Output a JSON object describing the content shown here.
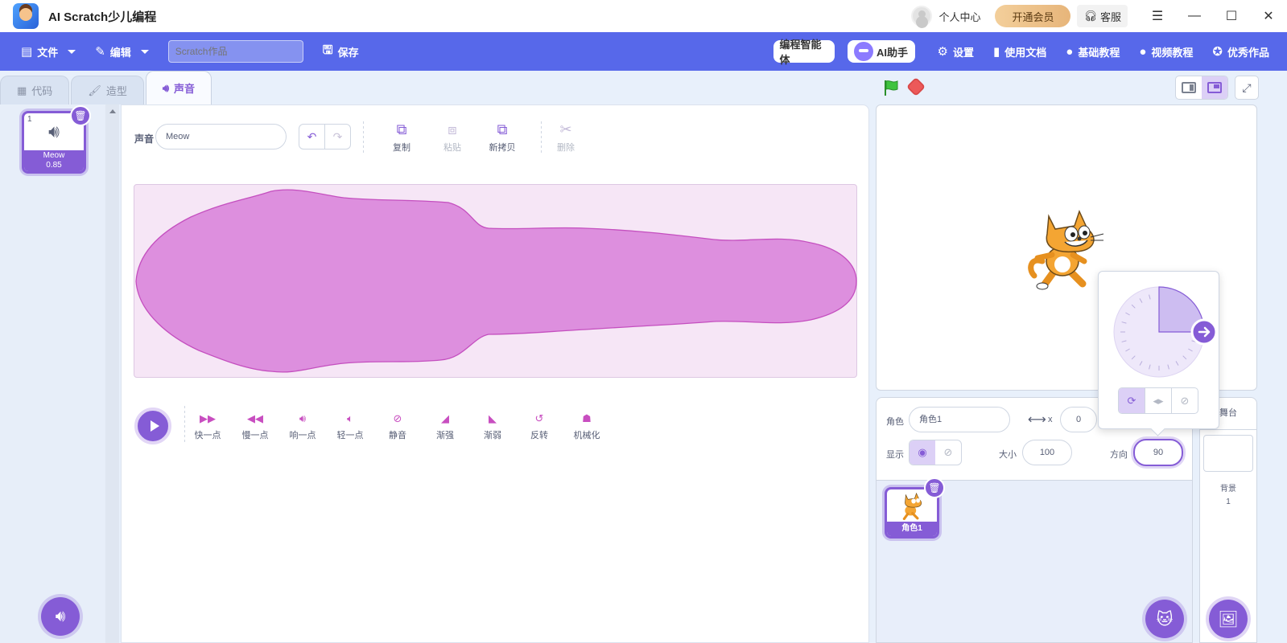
{
  "titlebar": {
    "app_title": "AI Scratch少儿编程",
    "user_center": "个人中心",
    "vip_button": "开通会员",
    "service_button": "客服"
  },
  "menubar": {
    "file": "文件",
    "edit": "编辑",
    "project_placeholder": "Scratch作品",
    "save": "保存",
    "smart_agent": "编程智能体",
    "ai_assistant": "AI助手",
    "settings": "设置",
    "docs": "使用文档",
    "basic_tutorial": "基础教程",
    "video_tutorial": "视频教程",
    "featured": "优秀作品"
  },
  "tabs": [
    {
      "label": "代码",
      "active": false
    },
    {
      "label": "造型",
      "active": false
    },
    {
      "label": "声音",
      "active": true
    }
  ],
  "sound_list": [
    {
      "index": "1",
      "name": "Meow",
      "duration": "0.85",
      "selected": true
    }
  ],
  "editor": {
    "name_label": "声音",
    "sound_name": "Meow",
    "tools": {
      "copy": "复制",
      "paste": "粘贴",
      "copy_new": "新拷贝",
      "delete": "删除"
    },
    "effects": [
      "快一点",
      "慢一点",
      "响一点",
      "轻一点",
      "静音",
      "渐强",
      "渐弱",
      "反转",
      "机械化"
    ]
  },
  "sprite_info": {
    "sprite_label": "角色",
    "sprite_name": "角色1",
    "x_label": "x",
    "x_value": "0",
    "show_label": "显示",
    "size_label": "大小",
    "size_value": "100",
    "direction_label": "方向",
    "direction_value": "90"
  },
  "sprites": [
    {
      "name": "角色1",
      "selected": true
    }
  ],
  "stage_pane": {
    "title": "舞台",
    "backdrops_label": "背景",
    "backdrops_count": "1"
  },
  "direction_dial": {
    "angle": 90
  },
  "colors": {
    "menu_bar": "#5768ea",
    "accent": "#855cd6",
    "waveform": "#dd8fde",
    "waveform_stroke": "#c44fbf",
    "vip": "#e7b57a",
    "flag": "#3ec33e",
    "stop": "#ec5959"
  }
}
